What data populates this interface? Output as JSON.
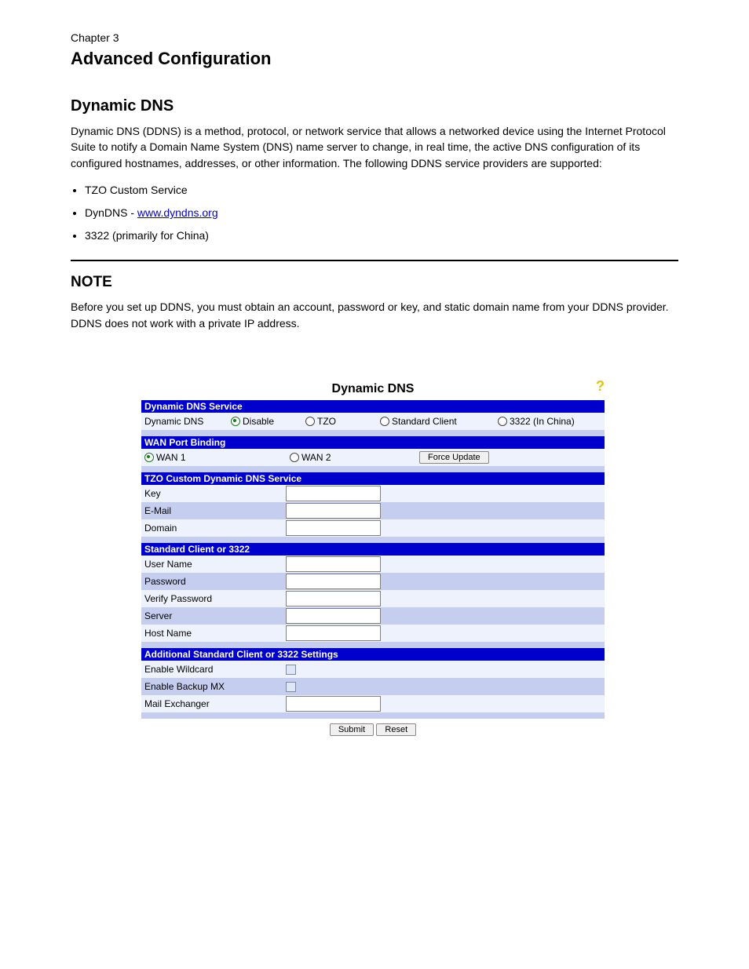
{
  "chapter_label": "Chapter 3",
  "chapter_title": "Advanced Configuration",
  "section_title": "Dynamic DNS",
  "intro_text": "Dynamic DNS (DDNS) is a method, protocol, or network service that allows a networked device using the Internet Protocol Suite to notify a Domain Name System (DNS) name server to change, in real time, the active DNS configuration of its configured hostnames, addresses, or other information. The following DDNS service providers are supported:",
  "bullets": {
    "b1": "TZO Custom Service",
    "b2_prefix": "DynDNS - ",
    "b2_link": "www.dyndns.org",
    "b3": "3322 (primarily for China)"
  },
  "note_label": "NOTE",
  "note_text": "Before you set up DDNS, you must obtain an account, password or key, and static domain name from your DDNS provider. DDNS does not work with a private IP address.",
  "panel": {
    "title": "Dynamic DNS",
    "help_icon_glyph": "?",
    "s1_header": "Dynamic DNS Service",
    "s1_label": "Dynamic DNS",
    "s1_opt_disable": "Disable",
    "s1_opt_tzo": "TZO",
    "s1_opt_standard": "Standard Client",
    "s1_opt_3322": "3322 (In China)",
    "s2_header": "WAN Port Binding",
    "s2_opt_wan1": "WAN 1",
    "s2_opt_wan2": "WAN 2",
    "s2_button": "Force Update",
    "s3_header": "TZO Custom Dynamic DNS Service",
    "s3_key": "Key",
    "s3_email": "E-Mail",
    "s3_domain": "Domain",
    "s4_header": "Standard Client or 3322",
    "s4_username": "User Name",
    "s4_password": "Password",
    "s4_verify": "Verify Password",
    "s4_server": "Server",
    "s4_hostname": "Host Name",
    "s5_header": "Additional Standard Client or 3322 Settings",
    "s5_wildcard": "Enable Wildcard",
    "s5_backupmx": "Enable Backup MX",
    "s5_mailex": "Mail Exchanger",
    "submit": "Submit",
    "reset": "Reset"
  }
}
